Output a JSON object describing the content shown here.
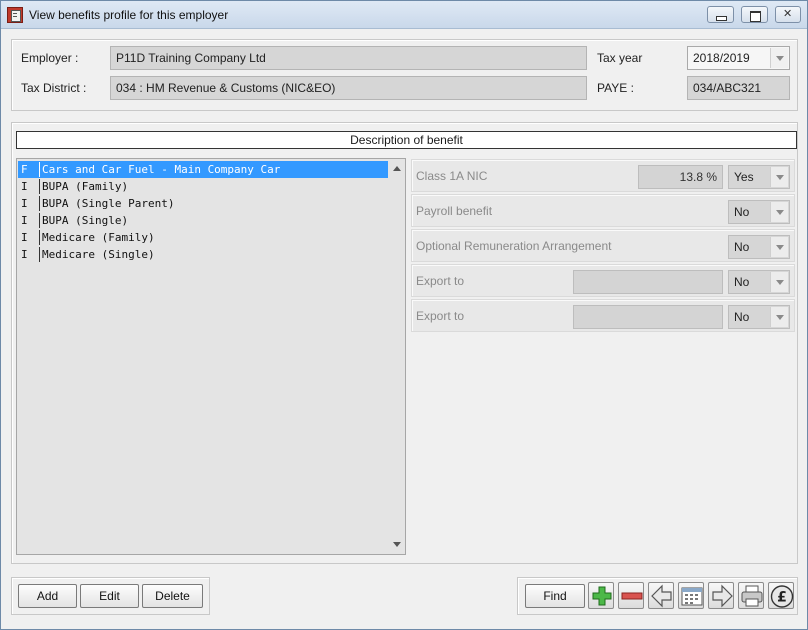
{
  "window": {
    "title": "View benefits profile for this employer"
  },
  "header": {
    "employer_label": "Employer :",
    "employer_value": "P11D Training Company Ltd",
    "tax_district_label": "Tax District :",
    "tax_district_value": "034 : HM Revenue & Customs (NIC&EO)",
    "tax_year_label": "Tax year",
    "tax_year_value": "2018/2019",
    "paye_label": "PAYE :",
    "paye_value": "034/ABC321"
  },
  "benefits": {
    "header": "Description of benefit",
    "items": [
      {
        "code": "F",
        "name": "Cars and Car Fuel - Main Company Car",
        "selected": true
      },
      {
        "code": "I",
        "name": "BUPA (Family)",
        "selected": false
      },
      {
        "code": "I",
        "name": "BUPA (Single Parent)",
        "selected": false
      },
      {
        "code": "I",
        "name": "BUPA (Single)",
        "selected": false
      },
      {
        "code": "I",
        "name": "Medicare (Family)",
        "selected": false
      },
      {
        "code": "I",
        "name": "Medicare (Single)",
        "selected": false
      }
    ]
  },
  "details": {
    "class1a_label": "Class 1A NIC",
    "class1a_rate": "13.8 %",
    "class1a_value": "Yes",
    "payroll_label": "Payroll benefit",
    "payroll_value": "No",
    "ora_label": "Optional Remuneration Arrangement",
    "ora_value": "No",
    "export1_label": "Export to",
    "export1_field": "",
    "export1_value": "No",
    "export2_label": "Export to",
    "export2_field": "",
    "export2_value": "No"
  },
  "buttons": {
    "add": "Add",
    "edit": "Edit",
    "delete": "Delete",
    "find": "Find"
  },
  "toolbar_icons": [
    "add-icon",
    "remove-icon",
    "previous-icon",
    "calendar-icon",
    "next-icon",
    "print-icon",
    "pound-icon"
  ]
}
